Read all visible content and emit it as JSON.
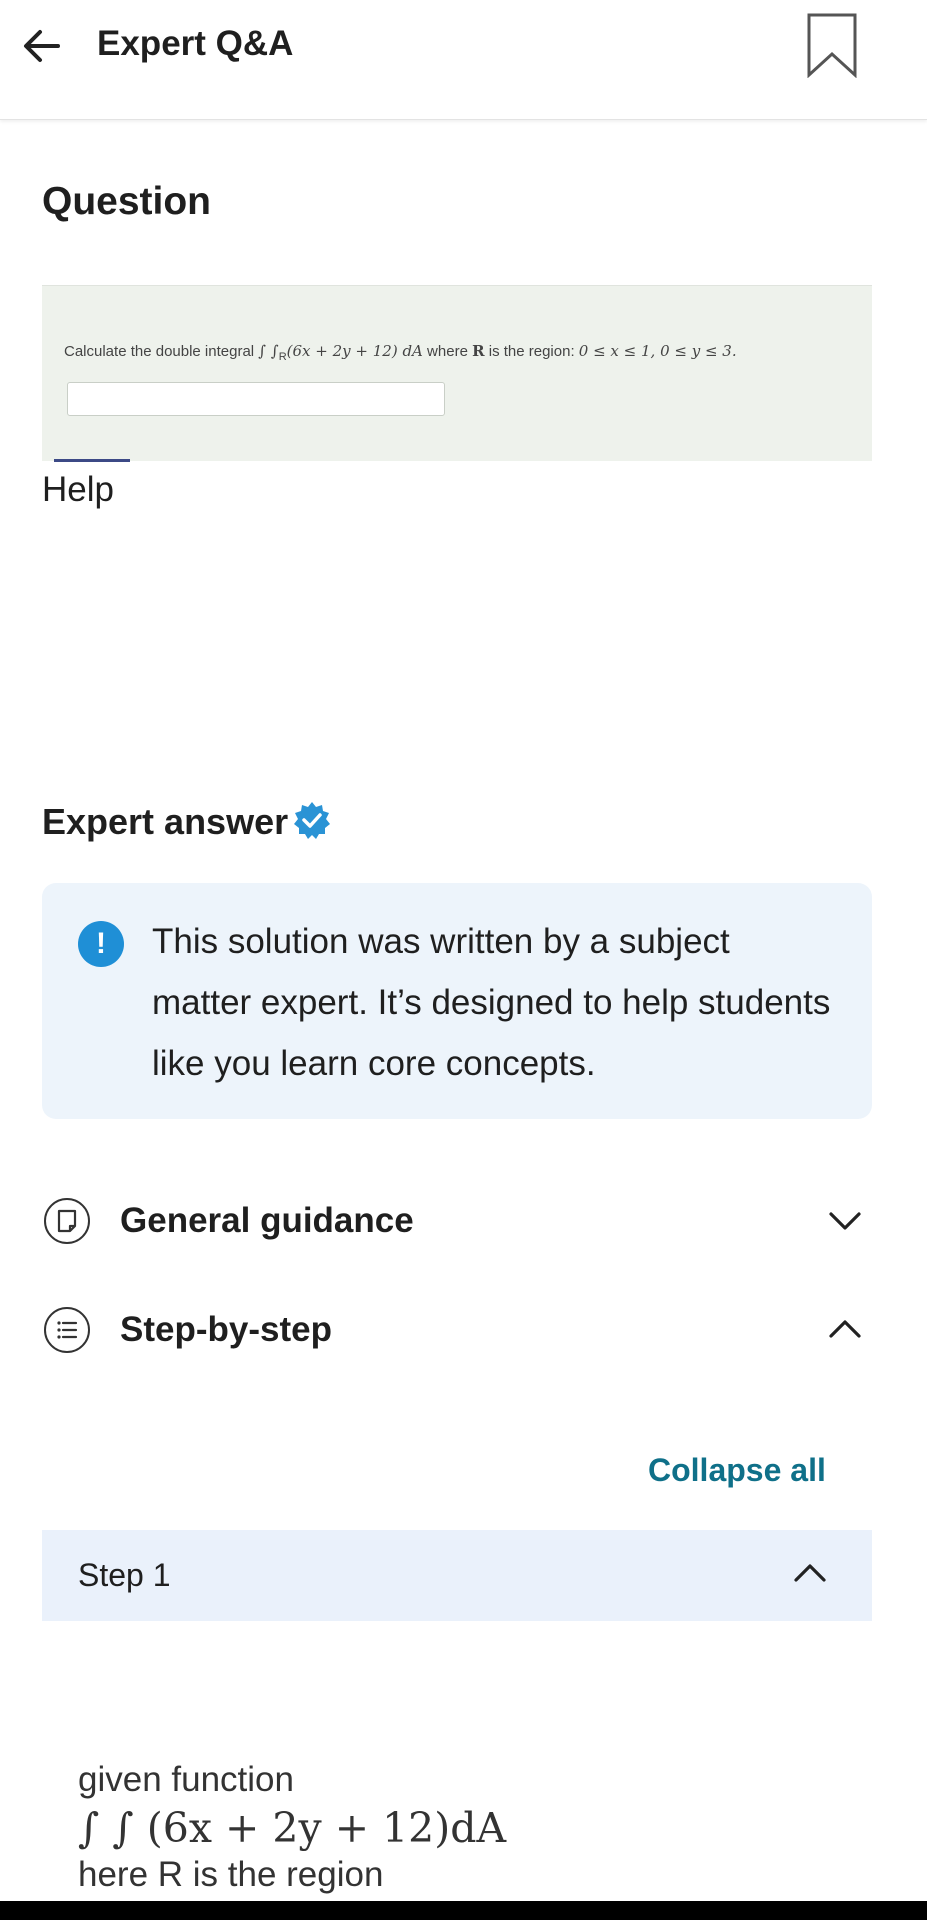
{
  "header": {
    "title": "Expert Q&A",
    "back_icon": "arrow-left-icon",
    "bookmark_icon": "bookmark-icon"
  },
  "question": {
    "heading": "Question",
    "image_text": {
      "prefix": "Calculate the double integral ",
      "integral": "∫ ∫",
      "sub": "R",
      "expr": "(6x + 2y + 12) dA",
      "where": " where ",
      "R": "R",
      "region_label": " is the region: ",
      "region": "0 ≤ x ≤ 1, 0 ≤ y ≤ 3."
    },
    "help": "Help"
  },
  "expert_answer": {
    "heading": "Expert answer",
    "verified_icon": "verified-badge-icon",
    "notice": "This solution was written by a subject matter expert. It’s designed to help students like you learn core concepts.",
    "sections": [
      {
        "label": "General guidance",
        "icon": "guidance-doc-icon",
        "state": "collapsed"
      },
      {
        "label": "Step-by-step",
        "icon": "list-icon",
        "state": "expanded"
      }
    ],
    "collapse_all": "Collapse all",
    "step": {
      "label": "Step 1"
    },
    "solution": {
      "line1": "given function",
      "formula": "∫ ∫ (6x + 2y + 12)dA",
      "line2": "here R is the region"
    }
  },
  "colors": {
    "accent": "#0f7089",
    "notice_bg": "#edf4fb",
    "step_bg": "#eaf1fb",
    "info": "#1f8fd6",
    "verified": "#2a93d5"
  }
}
